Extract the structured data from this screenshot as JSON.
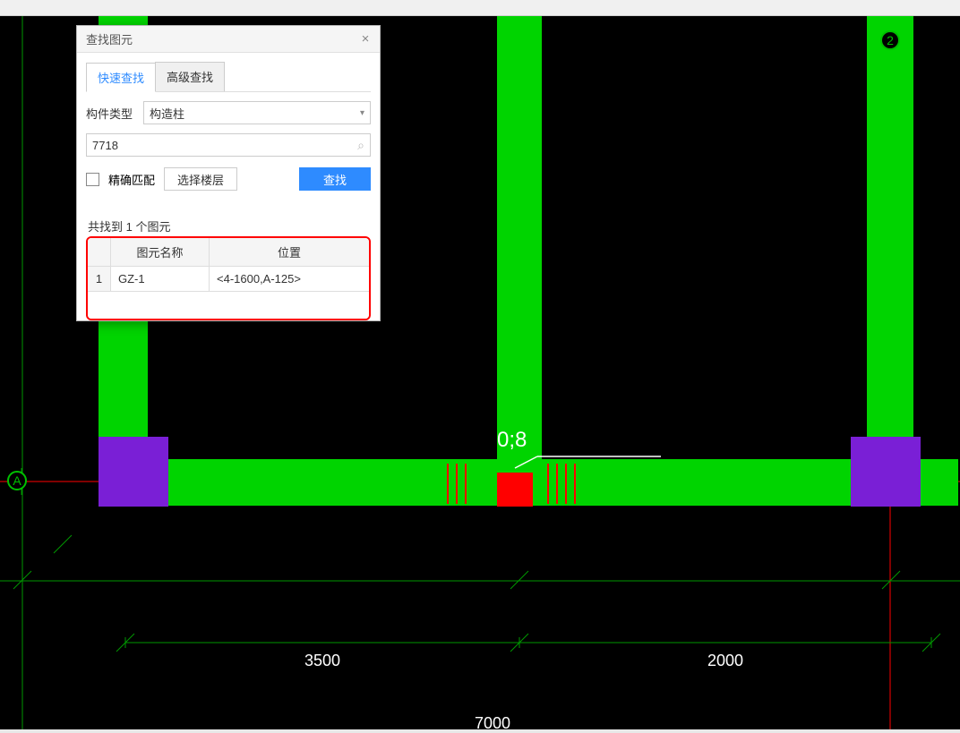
{
  "dialog": {
    "title": "查找图元",
    "tabs": {
      "quick": "快速查找",
      "advanced": "高级查找"
    },
    "type_label": "构件类型",
    "type_value": "构造柱",
    "search_value": "7718",
    "exact_label": "精确匹配",
    "floor_button": "选择楼层",
    "find_button": "查找",
    "result_summary": "共找到 1 个图元",
    "headers": {
      "name": "图元名称",
      "pos": "位置"
    },
    "rows": [
      {
        "idx": "1",
        "name": "GZ-1",
        "pos": "<4-1600,A-125>"
      }
    ]
  },
  "canvas": {
    "axis_a": "A",
    "axis_2": "2",
    "dim_left": "3500",
    "dim_right": "2000",
    "dim_total": "7000",
    "cursor_coord": "0;8"
  }
}
